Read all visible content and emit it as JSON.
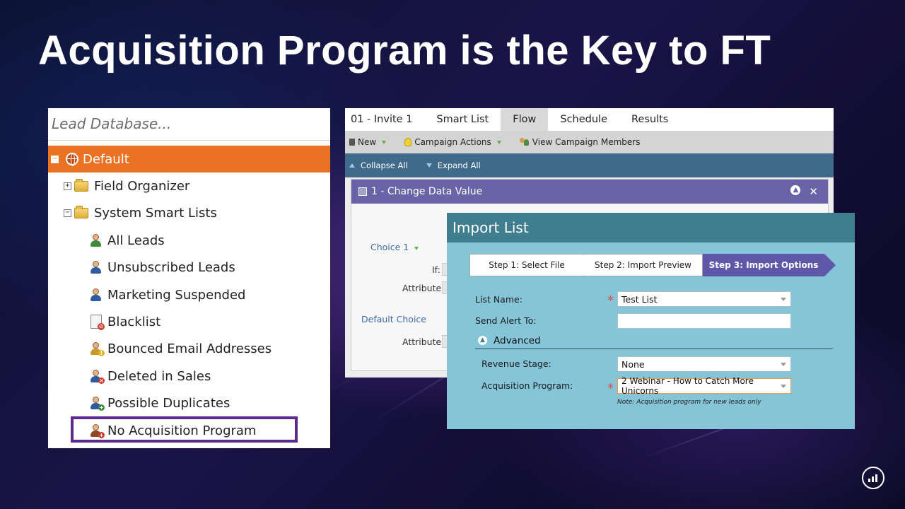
{
  "slide": {
    "title": "Acquisition Program is the Key to FT"
  },
  "tree": {
    "search_placeholder": "Lead Database...",
    "root": "Default",
    "items": [
      {
        "label": "Field Organizer"
      },
      {
        "label": "System Smart Lists"
      },
      {
        "label": "All Leads"
      },
      {
        "label": "Unsubscribed Leads"
      },
      {
        "label": "Marketing Suspended"
      },
      {
        "label": "Blacklist"
      },
      {
        "label": "Bounced Email Addresses"
      },
      {
        "label": "Deleted in Sales"
      },
      {
        "label": "Possible Duplicates"
      },
      {
        "label": "No Acquisition Program"
      }
    ]
  },
  "campaign": {
    "tabs": [
      {
        "label": "01 - Invite 1"
      },
      {
        "label": "Smart List"
      },
      {
        "label": "Flow"
      },
      {
        "label": "Schedule"
      },
      {
        "label": "Results"
      }
    ],
    "toolbar": {
      "new": "New",
      "campaign_actions": "Campaign Actions",
      "view_members": "View Campaign Members"
    },
    "subbar": {
      "collapse": "Collapse All",
      "expand": "Expand All"
    },
    "flow_step": {
      "title": "1 - Change Data Value",
      "choice": "Choice 1",
      "if_label": "If:",
      "attribute_label": "Attribute:",
      "default_choice": "Default Choice",
      "default_attribute_label": "Attribute:"
    }
  },
  "import_dialog": {
    "title": "Import List",
    "steps": [
      "Step 1: Select File",
      "Step 2: Import Preview",
      "Step 3: Import Options"
    ],
    "list_name_label": "List Name:",
    "list_name_value": "Test List",
    "send_alert_label": "Send Alert To:",
    "send_alert_value": "",
    "advanced_label": "Advanced",
    "revenue_stage_label": "Revenue Stage:",
    "revenue_stage_value": "None",
    "acq_program_label": "Acquisition Program:",
    "acq_program_value": "2 Webinar - How to Catch More Unicorns",
    "note": "Note: Acquisition program for new leads only"
  },
  "colors": {
    "orange": "#ea7223",
    "purple": "#5b2a8a",
    "teal": "#86c4d8"
  },
  "icons": [
    "globe-icon",
    "folder-icon",
    "person-icon",
    "bulb-icon",
    "marketo-logo-icon"
  ]
}
